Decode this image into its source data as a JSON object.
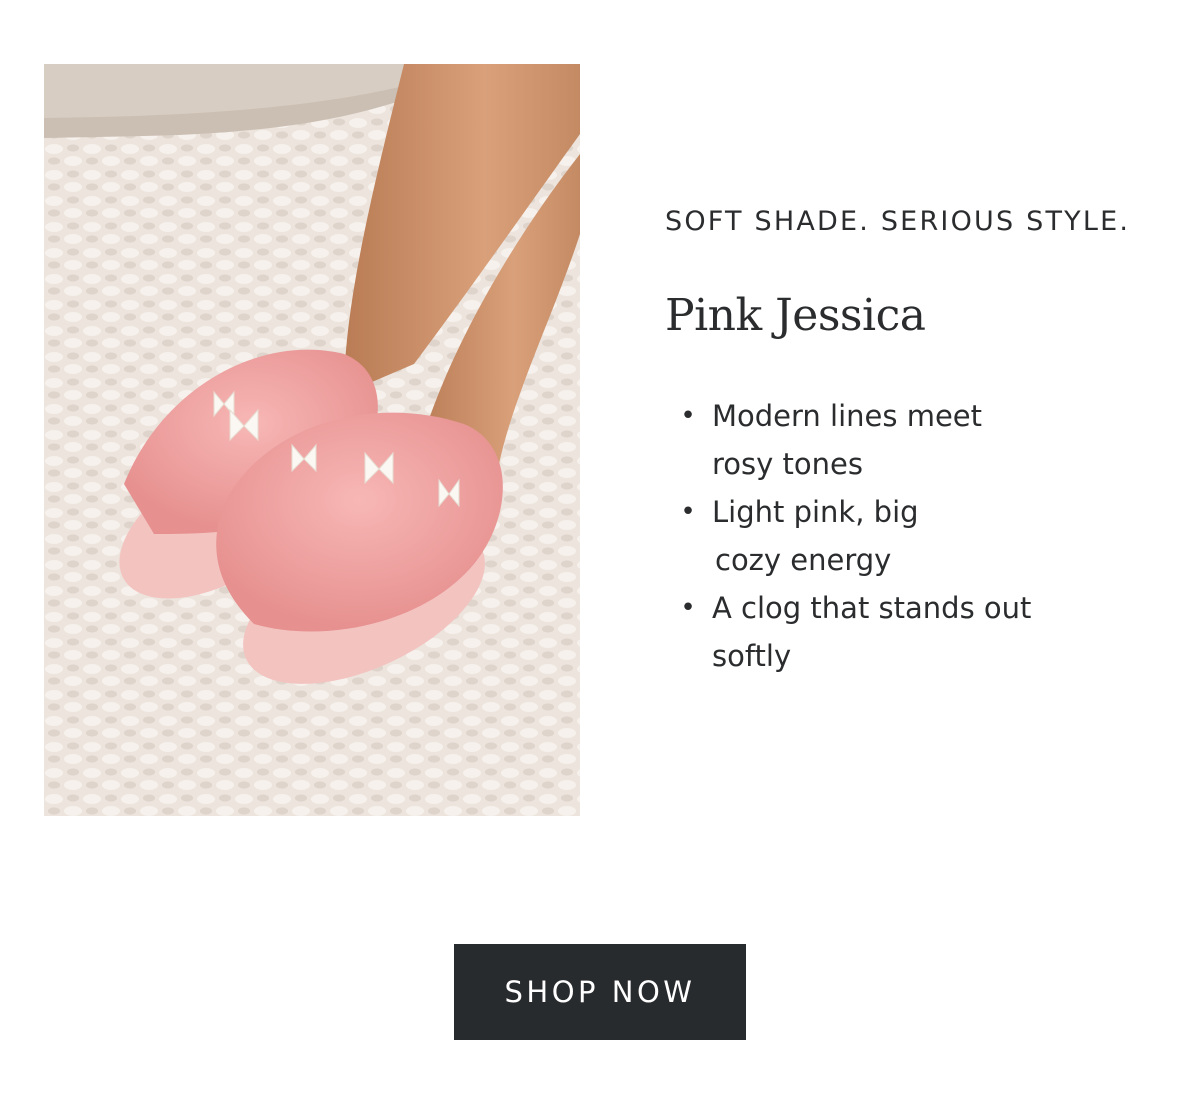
{
  "hero_image": {
    "alt": "Pink fuzzy criss-cross slippers with white satin bows worn on a cream knit rug"
  },
  "content": {
    "eyebrow": "SOFT SHADE. SERIOUS STYLE.",
    "product_name": "Pink Jessica",
    "features": [
      {
        "lines": [
          "Modern lines meet",
          "rosy tones"
        ]
      },
      {
        "lines": [
          "Light pink, big",
          "cozy energy"
        ]
      },
      {
        "lines": [
          "A clog that stands out",
          "softly"
        ]
      }
    ],
    "bullet_symbol": "•"
  },
  "cta": {
    "label": "SHOP NOW"
  },
  "colors": {
    "text": "#2a2c2e",
    "button_bg": "#282b2d",
    "button_text": "#ffffff",
    "slipper_pink": "#f0a9a9",
    "rug": "#ebe3dc"
  }
}
